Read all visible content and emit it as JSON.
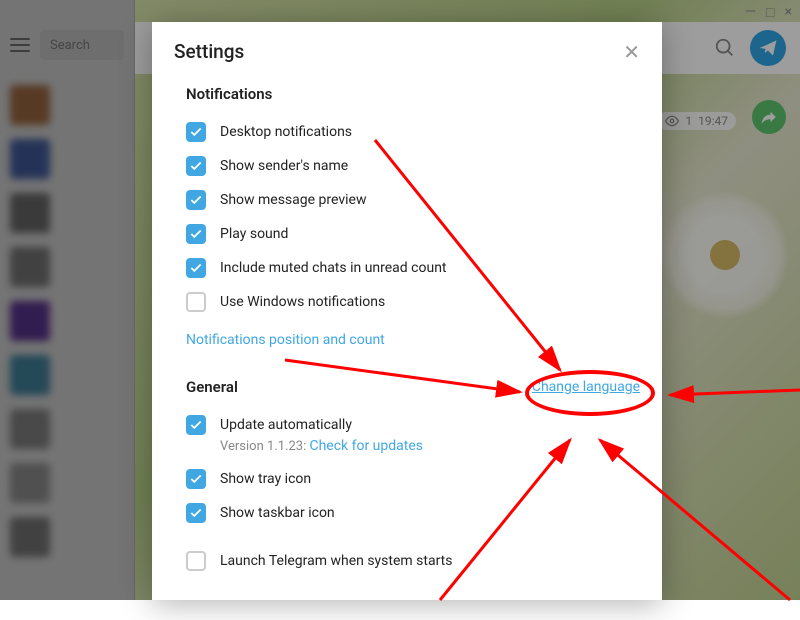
{
  "window_controls": {
    "minimize": "—",
    "maximize": "□",
    "close": "×"
  },
  "sidebar": {
    "search_placeholder": "Search"
  },
  "content": {
    "view_count": "1",
    "timestamp": "19:47"
  },
  "modal": {
    "title": "Settings",
    "sections": {
      "notifications": {
        "header": "Notifications",
        "items": [
          {
            "label": "Desktop notifications",
            "checked": true
          },
          {
            "label": "Show sender's name",
            "checked": true
          },
          {
            "label": "Show message preview",
            "checked": true
          },
          {
            "label": "Play sound",
            "checked": true
          },
          {
            "label": "Include muted chats in unread count",
            "checked": true
          },
          {
            "label": "Use Windows notifications",
            "checked": false
          }
        ],
        "link": "Notifications position and count"
      },
      "general": {
        "header": "General",
        "change_lang": "Change language",
        "items": [
          {
            "label": "Update automatically",
            "checked": true
          },
          {
            "label": "Show tray icon",
            "checked": true
          },
          {
            "label": "Show taskbar icon",
            "checked": true
          },
          {
            "label": "Launch Telegram when system starts",
            "checked": false
          }
        ],
        "version_prefix": "Version 1.1.23: ",
        "version_link": "Check for updates"
      }
    }
  },
  "avatar_colors": [
    "#c08050",
    "#5070c0",
    "#808080",
    "#909090",
    "#7040b0",
    "#50a0c0",
    "#a0a0a0",
    "#b0b0b0",
    "#909090"
  ]
}
